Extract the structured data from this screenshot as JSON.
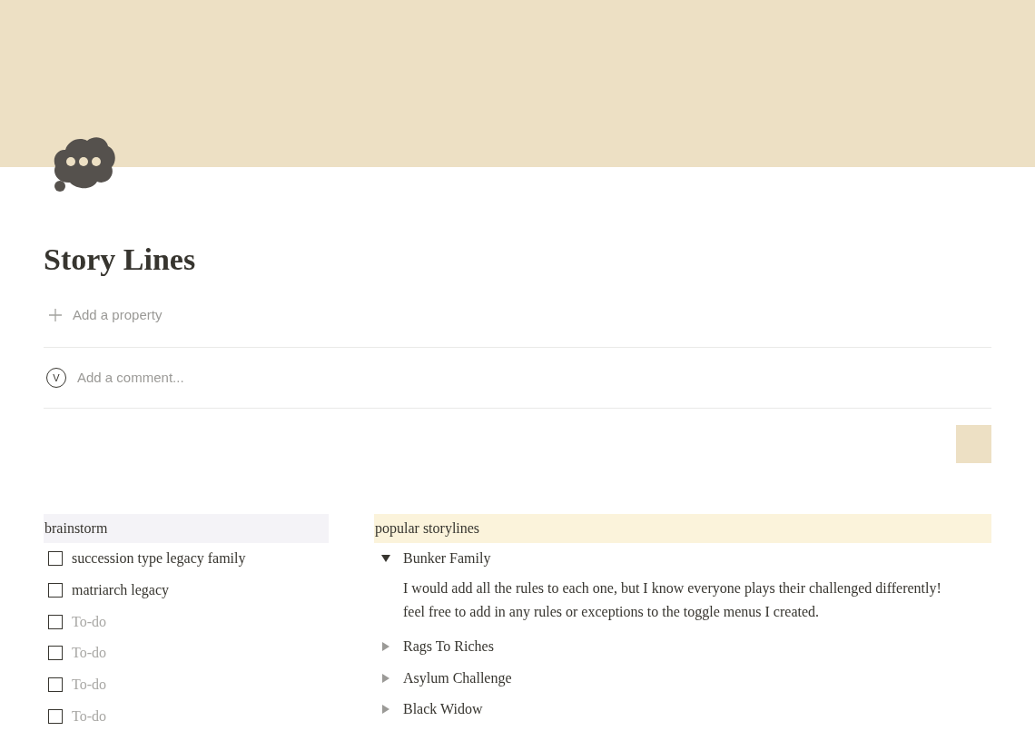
{
  "page": {
    "title": "Story Lines"
  },
  "add_property": {
    "label": "Add a property"
  },
  "comment": {
    "avatar": "V",
    "placeholder": "Add a comment..."
  },
  "brainstorm": {
    "heading": "brainstorm",
    "todos": [
      {
        "text": "succession type legacy family",
        "checked": false
      },
      {
        "text": "matriarch legacy",
        "checked": false
      },
      {
        "placeholder": "To-do",
        "checked": false
      },
      {
        "placeholder": "To-do",
        "checked": false
      },
      {
        "placeholder": "To-do",
        "checked": false
      },
      {
        "placeholder": "To-do",
        "checked": false
      }
    ]
  },
  "storylines": {
    "heading": "popular storylines",
    "toggles": [
      {
        "label": "Bunker Family",
        "expanded": true,
        "lines": [
          "I would add all the rules to each one, but I know everyone plays their challenged differently!",
          "feel free to add in any rules or exceptions to the toggle menus I created."
        ]
      },
      {
        "label": "Rags To Riches",
        "expanded": false
      },
      {
        "label": "Asylum Challenge",
        "expanded": false
      },
      {
        "label": "Black Widow",
        "expanded": false
      }
    ]
  }
}
